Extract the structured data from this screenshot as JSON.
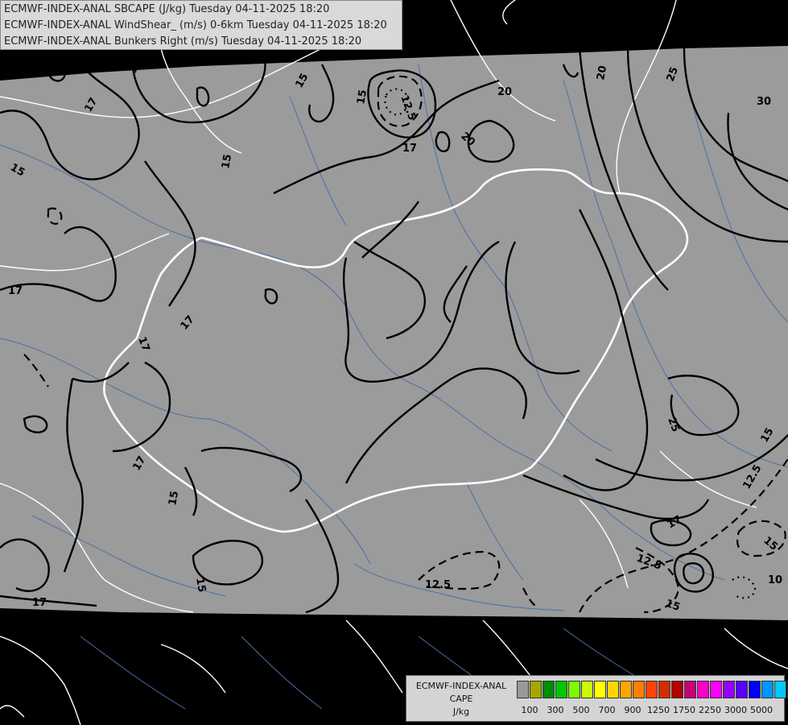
{
  "header": {
    "lines": [
      "ECMWF-INDEX-ANAL SBCAPE (J/kg) Tuesday 04-11-2025 18:20",
      "ECMWF-INDEX-ANAL WindShear_ (m/s) 0-6km Tuesday 04-11-2025 18:20",
      "ECMWF-INDEX-ANAL Bunkers Right (m/s) Tuesday 04-11-2025 18:20"
    ]
  },
  "legend": {
    "title_line1": "ECMWF-INDEX-ANAL",
    "title_line2": "CAPE",
    "units": "J/kg",
    "colors": [
      "#9a9a9a",
      "#a6a600",
      "#008c00",
      "#00c800",
      "#7cfc00",
      "#c8ff00",
      "#ffff00",
      "#ffd700",
      "#ffa500",
      "#ff7f00",
      "#ff4500",
      "#d22d00",
      "#b40000",
      "#c80078",
      "#ff00c8",
      "#ff00ff",
      "#9600ff",
      "#5a00ff",
      "#0000ff",
      "#0096ff",
      "#00c8ff",
      "#00ffff",
      "#96ffff",
      "#ffffff"
    ],
    "tick_labels": [
      "100",
      "300",
      "500",
      "700",
      "900",
      "1250",
      "1750",
      "2250",
      "3000",
      "5000"
    ]
  },
  "contour_labels": [
    "15",
    "17",
    "15",
    "12.5",
    "15",
    "20",
    "20",
    "20",
    "25",
    "30",
    "15",
    "17",
    "15",
    "17",
    "17",
    "17",
    "15",
    "15",
    "17",
    "25",
    "15",
    "12.5",
    "17",
    "12.5",
    "15",
    "10",
    "12.5",
    "15",
    "17"
  ],
  "colors": {
    "background": "#000000",
    "analysis_area": "#9b9b9b",
    "contour": "#000000",
    "borders": "#ffffff",
    "rivers": "#4a6fa8"
  }
}
